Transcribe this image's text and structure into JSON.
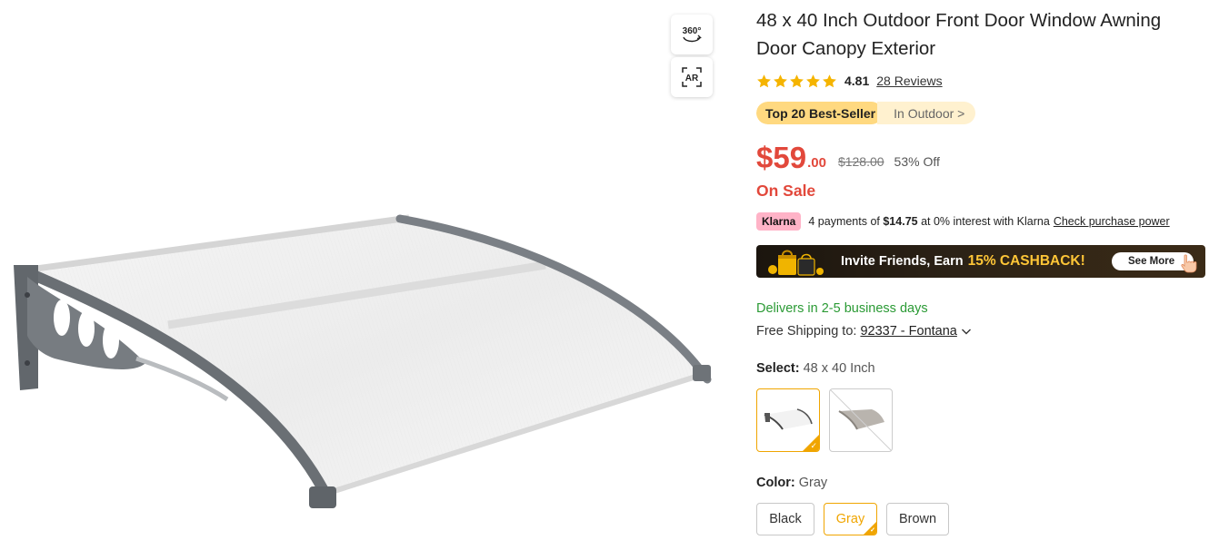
{
  "gallery": {
    "view_360_label": "360°",
    "view_ar_label": "AR",
    "main_image_icon": "door-awning-product-image"
  },
  "product": {
    "title": "48 x 40 Inch Outdoor Front Door Window Awning Door Canopy Exterior",
    "rating": {
      "value": "4.81",
      "reviews_link": "28 Reviews",
      "stars_icon": "star-icon",
      "star_count": 5,
      "star_color": "#f5b400"
    },
    "bestseller": {
      "badge": "Top 20 Best-Seller",
      "category_link": "In Outdoor >"
    },
    "price": {
      "currency": "$",
      "main": "59",
      "cents": ".00",
      "original": "$128.00",
      "discount": "53% Off",
      "color": "#e2483b"
    },
    "sale_status": "On Sale",
    "klarna": {
      "badge": "Klarna",
      "text_before": "4 payments of",
      "amount": "$14.75",
      "text_after": "at 0% interest with Klarna",
      "link": "Check purchase power"
    },
    "banner": {
      "text": "Invite Friends, Earn",
      "highlight": "15% CASHBACK!",
      "button": "See More"
    },
    "delivery": {
      "estimate": "Delivers in 2-5 business days",
      "shipping_label": "Free Shipping to:",
      "location": "92337 - Fontana",
      "color": "#2a9a34"
    },
    "size_selector": {
      "label": "Select:",
      "selected": "48 x 40 Inch"
    },
    "color_selector": {
      "label": "Color:",
      "selected": "Gray",
      "options": [
        "Black",
        "Gray",
        "Brown"
      ],
      "accent": "#f0a500"
    }
  }
}
